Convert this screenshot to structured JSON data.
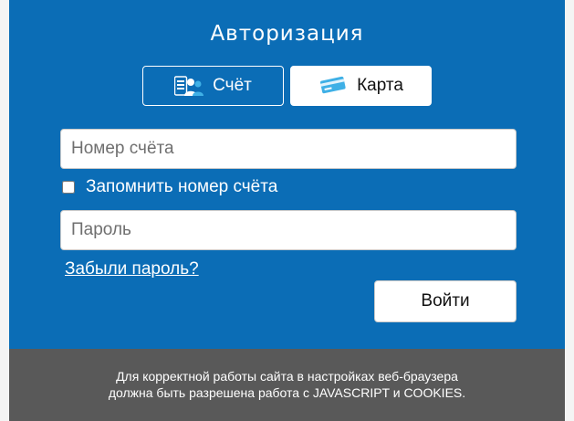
{
  "auth": {
    "title": "Авторизация",
    "tabs": [
      {
        "label": "Счёт",
        "icon": "account-users-icon",
        "active": true
      },
      {
        "label": "Карта",
        "icon": "card-icon",
        "active": false
      }
    ],
    "account_field": {
      "placeholder": "Номер счёта",
      "value": ""
    },
    "remember": {
      "label": "Запомнить номер счёта",
      "checked": false
    },
    "password_field": {
      "placeholder": "Пароль",
      "value": ""
    },
    "forgot_link": "Забыли пароль?",
    "login_button": "Войти"
  },
  "footer": {
    "line1": "Для корректной работы сайта в настройках веб-браузера",
    "line2": "должна быть разрешена работа с JAVASCRIPT и COOKIES."
  },
  "colors": {
    "panel": "#0b6db6",
    "footer": "#595959",
    "text_on_panel": "#ffffff",
    "icon_accent": "#3fb0e6"
  }
}
